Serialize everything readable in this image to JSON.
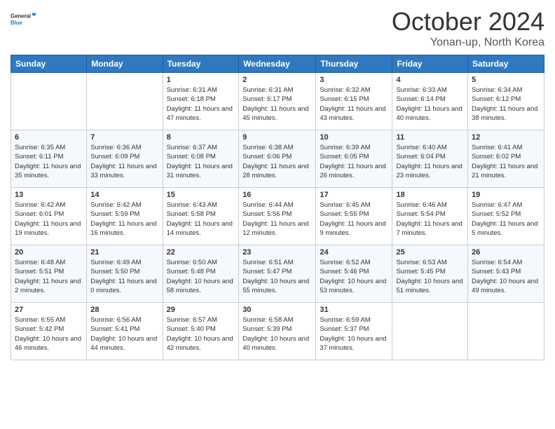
{
  "logo": {
    "general": "General",
    "blue": "Blue"
  },
  "title": "October 2024",
  "location": "Yonan-up, North Korea",
  "days_of_week": [
    "Sunday",
    "Monday",
    "Tuesday",
    "Wednesday",
    "Thursday",
    "Friday",
    "Saturday"
  ],
  "weeks": [
    [
      {
        "day": "",
        "info": ""
      },
      {
        "day": "",
        "info": ""
      },
      {
        "day": "1",
        "info": "Sunrise: 6:31 AM\nSunset: 6:18 PM\nDaylight: 11 hours and 47 minutes."
      },
      {
        "day": "2",
        "info": "Sunrise: 6:31 AM\nSunset: 6:17 PM\nDaylight: 11 hours and 45 minutes."
      },
      {
        "day": "3",
        "info": "Sunrise: 6:32 AM\nSunset: 6:15 PM\nDaylight: 11 hours and 43 minutes."
      },
      {
        "day": "4",
        "info": "Sunrise: 6:33 AM\nSunset: 6:14 PM\nDaylight: 11 hours and 40 minutes."
      },
      {
        "day": "5",
        "info": "Sunrise: 6:34 AM\nSunset: 6:12 PM\nDaylight: 11 hours and 38 minutes."
      }
    ],
    [
      {
        "day": "6",
        "info": "Sunrise: 6:35 AM\nSunset: 6:11 PM\nDaylight: 11 hours and 35 minutes."
      },
      {
        "day": "7",
        "info": "Sunrise: 6:36 AM\nSunset: 6:09 PM\nDaylight: 11 hours and 33 minutes."
      },
      {
        "day": "8",
        "info": "Sunrise: 6:37 AM\nSunset: 6:08 PM\nDaylight: 11 hours and 31 minutes."
      },
      {
        "day": "9",
        "info": "Sunrise: 6:38 AM\nSunset: 6:06 PM\nDaylight: 11 hours and 28 minutes."
      },
      {
        "day": "10",
        "info": "Sunrise: 6:39 AM\nSunset: 6:05 PM\nDaylight: 11 hours and 26 minutes."
      },
      {
        "day": "11",
        "info": "Sunrise: 6:40 AM\nSunset: 6:04 PM\nDaylight: 11 hours and 23 minutes."
      },
      {
        "day": "12",
        "info": "Sunrise: 6:41 AM\nSunset: 6:02 PM\nDaylight: 11 hours and 21 minutes."
      }
    ],
    [
      {
        "day": "13",
        "info": "Sunrise: 6:42 AM\nSunset: 6:01 PM\nDaylight: 11 hours and 19 minutes."
      },
      {
        "day": "14",
        "info": "Sunrise: 6:42 AM\nSunset: 5:59 PM\nDaylight: 11 hours and 16 minutes."
      },
      {
        "day": "15",
        "info": "Sunrise: 6:43 AM\nSunset: 5:58 PM\nDaylight: 11 hours and 14 minutes."
      },
      {
        "day": "16",
        "info": "Sunrise: 6:44 AM\nSunset: 5:56 PM\nDaylight: 11 hours and 12 minutes."
      },
      {
        "day": "17",
        "info": "Sunrise: 6:45 AM\nSunset: 5:55 PM\nDaylight: 11 hours and 9 minutes."
      },
      {
        "day": "18",
        "info": "Sunrise: 6:46 AM\nSunset: 5:54 PM\nDaylight: 11 hours and 7 minutes."
      },
      {
        "day": "19",
        "info": "Sunrise: 6:47 AM\nSunset: 5:52 PM\nDaylight: 11 hours and 5 minutes."
      }
    ],
    [
      {
        "day": "20",
        "info": "Sunrise: 6:48 AM\nSunset: 5:51 PM\nDaylight: 11 hours and 2 minutes."
      },
      {
        "day": "21",
        "info": "Sunrise: 6:49 AM\nSunset: 5:50 PM\nDaylight: 11 hours and 0 minutes."
      },
      {
        "day": "22",
        "info": "Sunrise: 6:50 AM\nSunset: 5:48 PM\nDaylight: 10 hours and 58 minutes."
      },
      {
        "day": "23",
        "info": "Sunrise: 6:51 AM\nSunset: 5:47 PM\nDaylight: 10 hours and 55 minutes."
      },
      {
        "day": "24",
        "info": "Sunrise: 6:52 AM\nSunset: 5:46 PM\nDaylight: 10 hours and 53 minutes."
      },
      {
        "day": "25",
        "info": "Sunrise: 6:53 AM\nSunset: 5:45 PM\nDaylight: 10 hours and 51 minutes."
      },
      {
        "day": "26",
        "info": "Sunrise: 6:54 AM\nSunset: 5:43 PM\nDaylight: 10 hours and 49 minutes."
      }
    ],
    [
      {
        "day": "27",
        "info": "Sunrise: 6:55 AM\nSunset: 5:42 PM\nDaylight: 10 hours and 46 minutes."
      },
      {
        "day": "28",
        "info": "Sunrise: 6:56 AM\nSunset: 5:41 PM\nDaylight: 10 hours and 44 minutes."
      },
      {
        "day": "29",
        "info": "Sunrise: 6:57 AM\nSunset: 5:40 PM\nDaylight: 10 hours and 42 minutes."
      },
      {
        "day": "30",
        "info": "Sunrise: 6:58 AM\nSunset: 5:39 PM\nDaylight: 10 hours and 40 minutes."
      },
      {
        "day": "31",
        "info": "Sunrise: 6:59 AM\nSunset: 5:37 PM\nDaylight: 10 hours and 37 minutes."
      },
      {
        "day": "",
        "info": ""
      },
      {
        "day": "",
        "info": ""
      }
    ]
  ]
}
